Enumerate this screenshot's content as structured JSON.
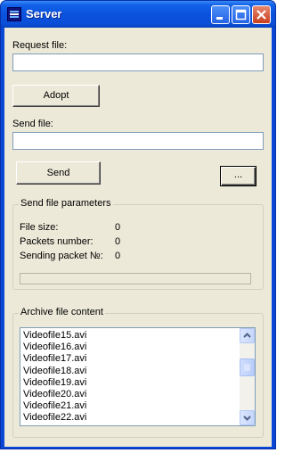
{
  "window": {
    "title": "Server",
    "icons": {
      "app": "app-icon",
      "minimize": "minimize-icon",
      "maximize": "maximize-icon",
      "close": "close-icon"
    }
  },
  "request": {
    "label": "Request file:",
    "value": "",
    "button": "Adopt"
  },
  "send": {
    "label": "Send file:",
    "value": "",
    "button": "Send",
    "browse_button": "..."
  },
  "params": {
    "title": "Send file parameters",
    "rows": [
      {
        "label": "File size:",
        "value": "0"
      },
      {
        "label": "Packets number:",
        "value": "0"
      },
      {
        "label": "Sending packet №:",
        "value": "0"
      }
    ],
    "progress": 0
  },
  "archive": {
    "title": "Archive file content",
    "items": [
      "Videofile15.avi",
      "Videofile16.avi",
      "Videofile17.avi",
      "Videofile18.avi",
      "Videofile19.avi",
      "Videofile20.avi",
      "Videofile21.avi",
      "Videofile22.avi"
    ]
  },
  "colors": {
    "titlebar": "#0a52de",
    "client": "#ece9d8",
    "close": "#c8401f"
  }
}
